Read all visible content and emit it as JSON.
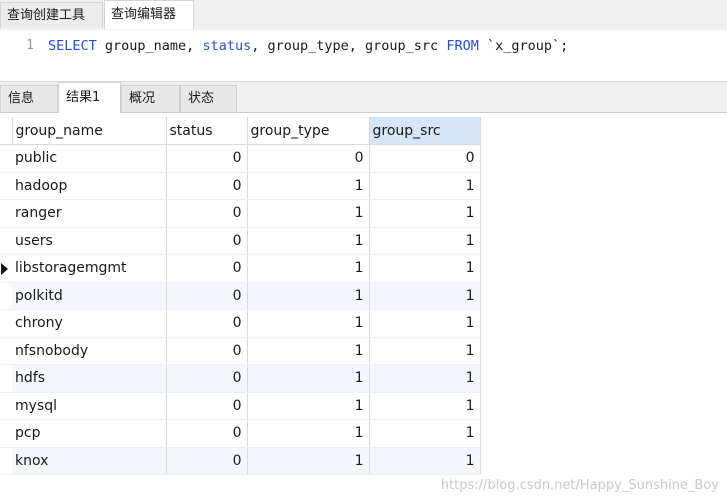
{
  "top_tabs": [
    {
      "label": "查询创建工具"
    },
    {
      "label": "查询编辑器"
    }
  ],
  "editor": {
    "line_number": "1",
    "kw_select": "SELECT",
    "cols": " group_name, ",
    "kw_status": "status",
    "cols2": ", group_type, group_src ",
    "kw_from": "FROM",
    "table": " `x_group`;"
  },
  "result_tabs": [
    {
      "label": "信息"
    },
    {
      "label": "结果1"
    },
    {
      "label": "概况"
    },
    {
      "label": "状态"
    }
  ],
  "columns": [
    "group_name",
    "status",
    "group_type",
    "group_src"
  ],
  "rows": [
    [
      "public",
      "0",
      "0",
      "0"
    ],
    [
      "hadoop",
      "0",
      "1",
      "1"
    ],
    [
      "ranger",
      "0",
      "1",
      "1"
    ],
    [
      "users",
      "0",
      "1",
      "1"
    ],
    [
      "libstoragemgmt",
      "0",
      "1",
      "1"
    ],
    [
      "polkitd",
      "0",
      "1",
      "1"
    ],
    [
      "chrony",
      "0",
      "1",
      "1"
    ],
    [
      "nfsnobody",
      "0",
      "1",
      "1"
    ],
    [
      "hdfs",
      "0",
      "1",
      "1"
    ],
    [
      "mysql",
      "0",
      "1",
      "1"
    ],
    [
      "pcp",
      "0",
      "1",
      "1"
    ],
    [
      "knox",
      "0",
      "1",
      "1"
    ]
  ],
  "watermark": "https://blog.csdn.net/Happy_Sunshine_Boy"
}
